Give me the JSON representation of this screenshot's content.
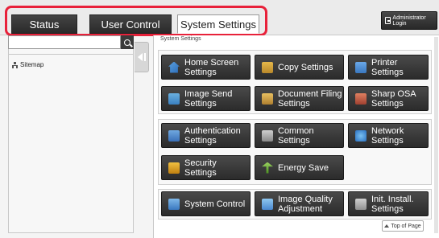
{
  "tabs": [
    {
      "label": "Status",
      "active": false
    },
    {
      "label": "User Control",
      "active": false
    },
    {
      "label": "System Settings",
      "active": true
    }
  ],
  "header": {
    "admin_login_label": "Administrator Login"
  },
  "sidebar": {
    "search": {
      "value": "",
      "placeholder": ""
    },
    "items": [
      {
        "label": "Sitemap",
        "icon": "sitemap-icon"
      }
    ]
  },
  "main": {
    "section_title": "System Settings",
    "groups": [
      {
        "tiles": [
          {
            "line1": "Home Screen",
            "line2": "Settings",
            "icon": "home-icon"
          },
          {
            "line1": "Copy Settings",
            "line2": "",
            "icon": "copy-icon"
          },
          {
            "line1": "Printer",
            "line2": "Settings",
            "icon": "printer-icon"
          },
          {
            "line1": "Image Send",
            "line2": "Settings",
            "icon": "image-send-icon"
          },
          {
            "line1": "Document Filing",
            "line2": "Settings",
            "icon": "document-filing-icon"
          },
          {
            "line1": "Sharp OSA",
            "line2": "Settings",
            "icon": "sharp-osa-icon"
          }
        ]
      },
      {
        "tiles": [
          {
            "line1": "Authentication",
            "line2": "Settings",
            "icon": "authentication-icon"
          },
          {
            "line1": "Common",
            "line2": "Settings",
            "icon": "common-settings-icon"
          },
          {
            "line1": "Network",
            "line2": "Settings",
            "icon": "network-icon"
          },
          {
            "line1": "Security",
            "line2": "Settings",
            "icon": "lock-icon"
          },
          {
            "line1": "Energy Save",
            "line2": "",
            "icon": "leaf-icon"
          }
        ]
      },
      {
        "tiles": [
          {
            "line1": "System Control",
            "line2": "",
            "icon": "system-control-icon"
          },
          {
            "line1": "Image Quality",
            "line2": "Adjustment",
            "icon": "image-quality-icon"
          },
          {
            "line1": "Init. Install.",
            "line2": "Settings",
            "icon": "init-install-icon"
          }
        ]
      }
    ],
    "top_of_page_label": "Top of Page"
  },
  "colors": {
    "highlight": "#e8213a",
    "tile_bg": "#333333",
    "tab_bg": "#2a2a2a"
  }
}
